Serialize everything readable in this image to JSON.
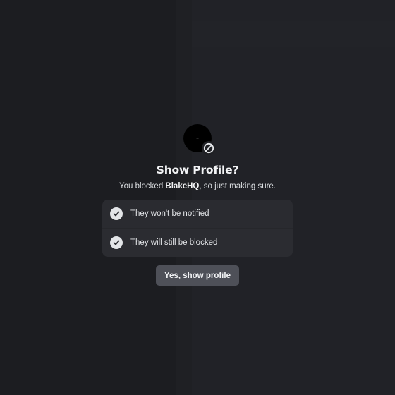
{
  "dialog": {
    "avatar_icon": "blocked-icon",
    "title": "Show Profile?",
    "subtitle_prefix": "You blocked ",
    "blocked_user": "BlakeHQ",
    "subtitle_suffix": ", so just making sure.",
    "items": [
      {
        "icon": "check-icon",
        "label": "They won't be notified"
      },
      {
        "icon": "check-icon",
        "label": "They will still be blocked"
      }
    ],
    "confirm_label": "Yes, show profile"
  },
  "colors": {
    "background": "#1f2024",
    "panel": "#2a2b30",
    "button": "#4e5058",
    "text": "#f2f3f5"
  }
}
